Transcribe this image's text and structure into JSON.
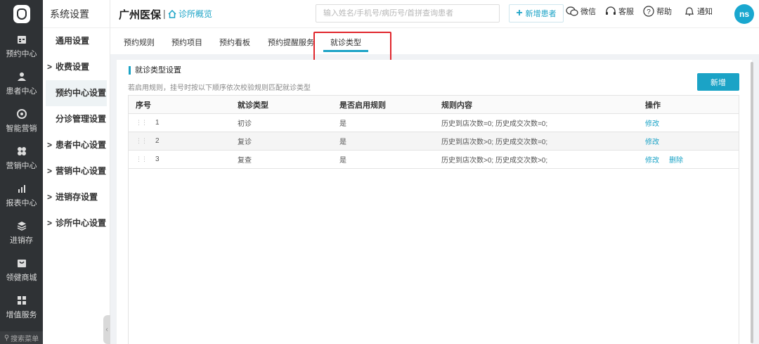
{
  "leftnav": {
    "items": [
      {
        "label": "预约中心",
        "icon": "calendar-icon"
      },
      {
        "label": "患者中心",
        "icon": "user-icon"
      },
      {
        "label": "智能营销",
        "icon": "marketing-icon"
      },
      {
        "label": "营销中心",
        "icon": "fan-icon"
      },
      {
        "label": "报表中心",
        "icon": "bar-chart-icon"
      },
      {
        "label": "进销存",
        "icon": "layers-icon"
      },
      {
        "label": "领健商城",
        "icon": "mall-icon"
      },
      {
        "label": "增值服务",
        "icon": "grid-icon"
      }
    ],
    "search_label": "搜索菜单"
  },
  "subnav": {
    "title": "系统设置",
    "items": [
      {
        "label": "通用设置",
        "arrow": ""
      },
      {
        "label": "收费设置",
        "arrow": ">"
      },
      {
        "label": "预约中心设置",
        "arrow": ""
      },
      {
        "label": "分诊管理设置",
        "arrow": ""
      },
      {
        "label": "患者中心设置",
        "arrow": ">"
      },
      {
        "label": "营销中心设置",
        "arrow": ">"
      },
      {
        "label": "进销存设置",
        "arrow": ">"
      },
      {
        "label": "诊所中心设置",
        "arrow": ">"
      }
    ]
  },
  "header": {
    "brand": "广州医保",
    "separator": "|",
    "overview": "诊所概览",
    "search_placeholder": "输入姓名/手机号/病历号/首拼查询患者",
    "add_patient": "新增患者",
    "wechat": "微信",
    "service": "客服",
    "help": "帮助",
    "notify": "通知",
    "avatar": "ns"
  },
  "tabs": [
    "预约规则",
    "预约项目",
    "预约看板",
    "预约提醒服务",
    "就诊类型"
  ],
  "section": {
    "title": "就诊类型设置",
    "desc": "若启用规则，挂号时按以下顺序依次校验规则匹配就诊类型",
    "new_button": "新增"
  },
  "table": {
    "headers": [
      "序号",
      "就诊类型",
      "是否启用规则",
      "规则内容",
      "操作"
    ],
    "rows": [
      {
        "no": "1",
        "type": "初诊",
        "enabled": "是",
        "rule": "历史到店次数=0;  历史成交次数=0;",
        "edit": "修改",
        "del": ""
      },
      {
        "no": "2",
        "type": "复诊",
        "enabled": "是",
        "rule": "历史到店次数>0;  历史成交次数=0;",
        "edit": "修改",
        "del": ""
      },
      {
        "no": "3",
        "type": "复查",
        "enabled": "是",
        "rule": "历史到店次数>0;  历史成交次数>0;",
        "edit": "修改",
        "del": "删除"
      }
    ]
  },
  "colors": {
    "accent": "#1ba3c6",
    "sidebar": "#2f3235",
    "highlight": "#e0262c"
  }
}
